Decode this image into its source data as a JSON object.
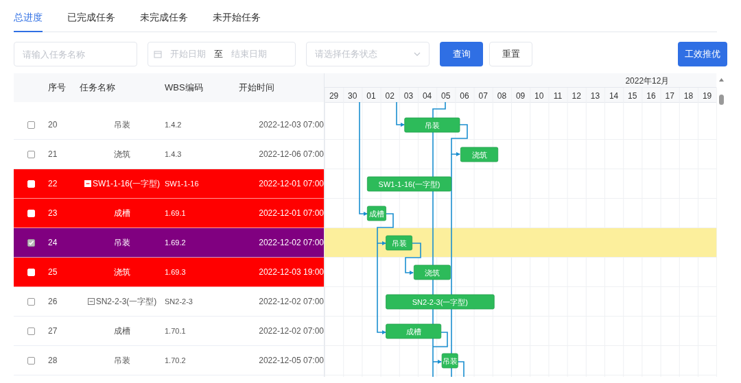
{
  "tabs": [
    {
      "label": "总进度",
      "selected": true
    },
    {
      "label": "已完成任务",
      "selected": false
    },
    {
      "label": "未完成任务",
      "selected": false
    },
    {
      "label": "未开始任务",
      "selected": false
    }
  ],
  "filters": {
    "task_name": {
      "placeholder": "请输入任务名称"
    },
    "date_range": {
      "start_placeholder": "开始日期",
      "separator": "至",
      "end_placeholder": "结束日期"
    },
    "status": {
      "placeholder": "请选择任务状态"
    },
    "buttons": [
      {
        "label": "查询",
        "kind": "primary"
      },
      {
        "label": "重置",
        "kind": "default"
      }
    ],
    "optimize_button": "工效推优"
  },
  "table": {
    "columns": [
      "序号",
      "任务名称",
      "WBS编码",
      "开始时间"
    ],
    "rows": [
      {
        "no": "20",
        "name": "吊装",
        "wbs": "1.4.2",
        "start": "2022-12-03 07:00",
        "checked": false,
        "kind": "task",
        "bar_label": "吊装"
      },
      {
        "no": "21",
        "name": "浇筑",
        "wbs": "1.4.3",
        "start": "2022-12-06 07:00",
        "checked": false,
        "kind": "task",
        "bar_label": "浇筑"
      },
      {
        "no": "22",
        "name": "SW1-1-16(一字型)",
        "wbs": "SW1-1-16",
        "start": "2022-12-01 07:00",
        "checked": false,
        "kind": "group",
        "expanded": true,
        "color": "#ff0000",
        "bar_label": "SW1-1-16(一字型)"
      },
      {
        "no": "23",
        "name": "成槽",
        "wbs": "1.69.1",
        "start": "2022-12-01 07:00",
        "checked": false,
        "kind": "task",
        "color": "#ff0000",
        "bar_label": "成槽"
      },
      {
        "no": "24",
        "name": "吊装",
        "wbs": "1.69.2",
        "start": "2022-12-02 07:00",
        "checked": true,
        "kind": "task",
        "color": "#800080",
        "bar_label": "吊装"
      },
      {
        "no": "25",
        "name": "浇筑",
        "wbs": "1.69.3",
        "start": "2022-12-03 19:00",
        "checked": false,
        "kind": "task",
        "color": "#ff0000",
        "bar_label": "浇筑"
      },
      {
        "no": "26",
        "name": "SN2-2-3(一字型)",
        "wbs": "SN2-2-3",
        "start": "2022-12-02 07:00",
        "checked": false,
        "kind": "group",
        "expanded": true,
        "bar_label": "SN2-2-3(一字型)"
      },
      {
        "no": "27",
        "name": "成槽",
        "wbs": "1.70.1",
        "start": "2022-12-02 07:00",
        "checked": false,
        "kind": "task",
        "bar_label": "成槽"
      },
      {
        "no": "28",
        "name": "吊装",
        "wbs": "1.70.2",
        "start": "2022-12-05 07:00",
        "checked": false,
        "kind": "task",
        "bar_label": "吊装"
      }
    ]
  },
  "gantt": {
    "month": "2022年12月",
    "days": [
      "29",
      "30",
      "01",
      "02",
      "03",
      "04",
      "05",
      "06",
      "07",
      "08",
      "09",
      "10",
      "11",
      "12",
      "13",
      "14",
      "15",
      "16",
      "17",
      "18",
      "19"
    ]
  }
}
